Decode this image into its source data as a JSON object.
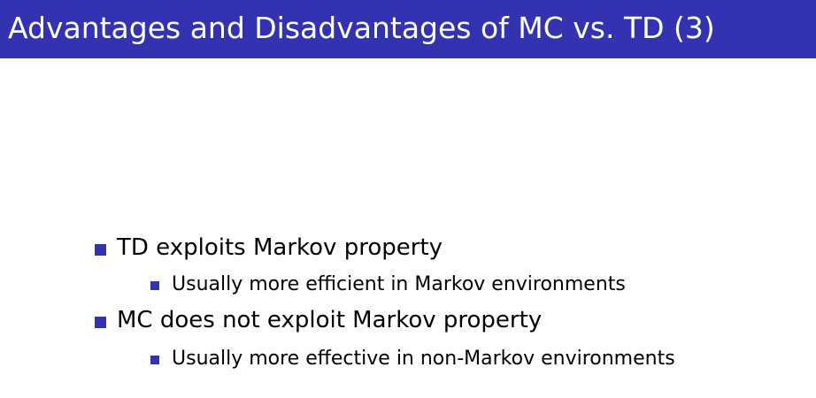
{
  "slide": {
    "title": "Advantages and Disadvantages of MC vs. TD (3)",
    "bullets": [
      {
        "text": "TD exploits Markov property",
        "sub": [
          "Usually more efficient in Markov environments"
        ]
      },
      {
        "text": "MC does not exploit Markov property",
        "sub": [
          "Usually more effective in non-Markov environments"
        ]
      }
    ]
  },
  "colors": {
    "title_bar": "#3333b2",
    "bullet": "#3333b2",
    "title_text": "#ffffff",
    "body_text": "#000000"
  }
}
